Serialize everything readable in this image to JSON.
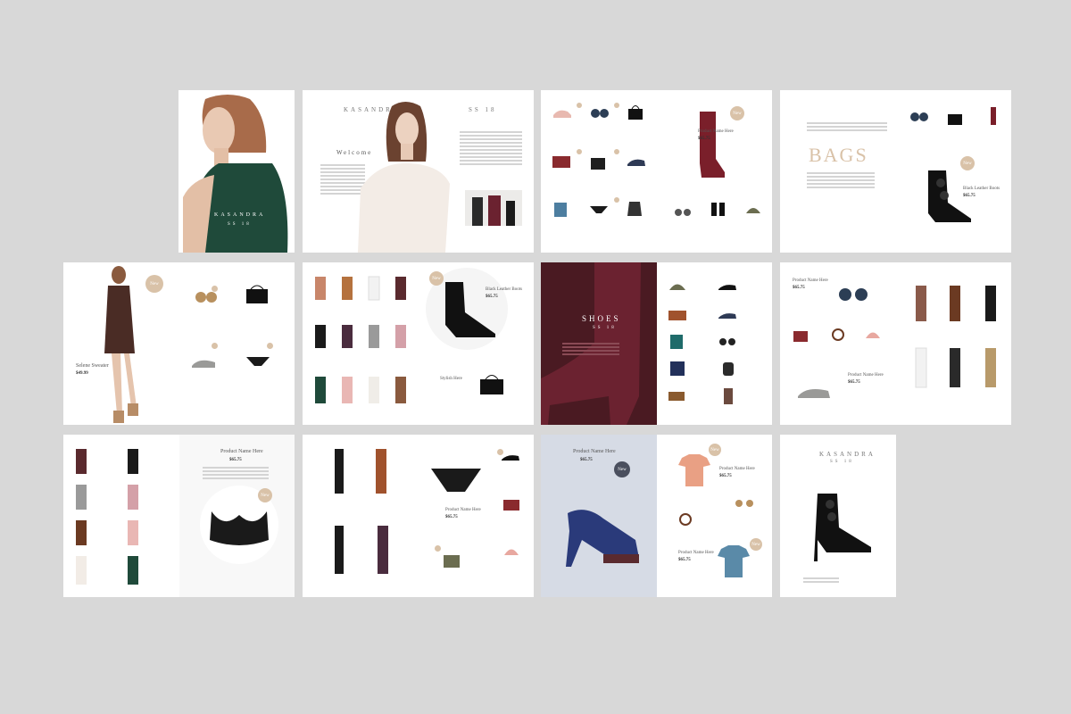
{
  "brand": "KASANDRA",
  "season": "SS 18",
  "welcome": "Welcome",
  "bags_title": "BAGS",
  "shoes_title": "SHOES",
  "new_badge": "New",
  "product_name": "Product Name Here",
  "price": "$65.75",
  "boots_name": "Black Leather Boots",
  "sweater_name": "Selene Sweater",
  "sweater_price": "$49.99",
  "stylish_item": "Stylish Here",
  "colors": {
    "background": "#d8d8d8",
    "page": "#ffffff",
    "accent": "#d9c2a8",
    "burgundy": "#6b2230",
    "dark": "#1a1a1a",
    "green": "#1f4a3a"
  }
}
